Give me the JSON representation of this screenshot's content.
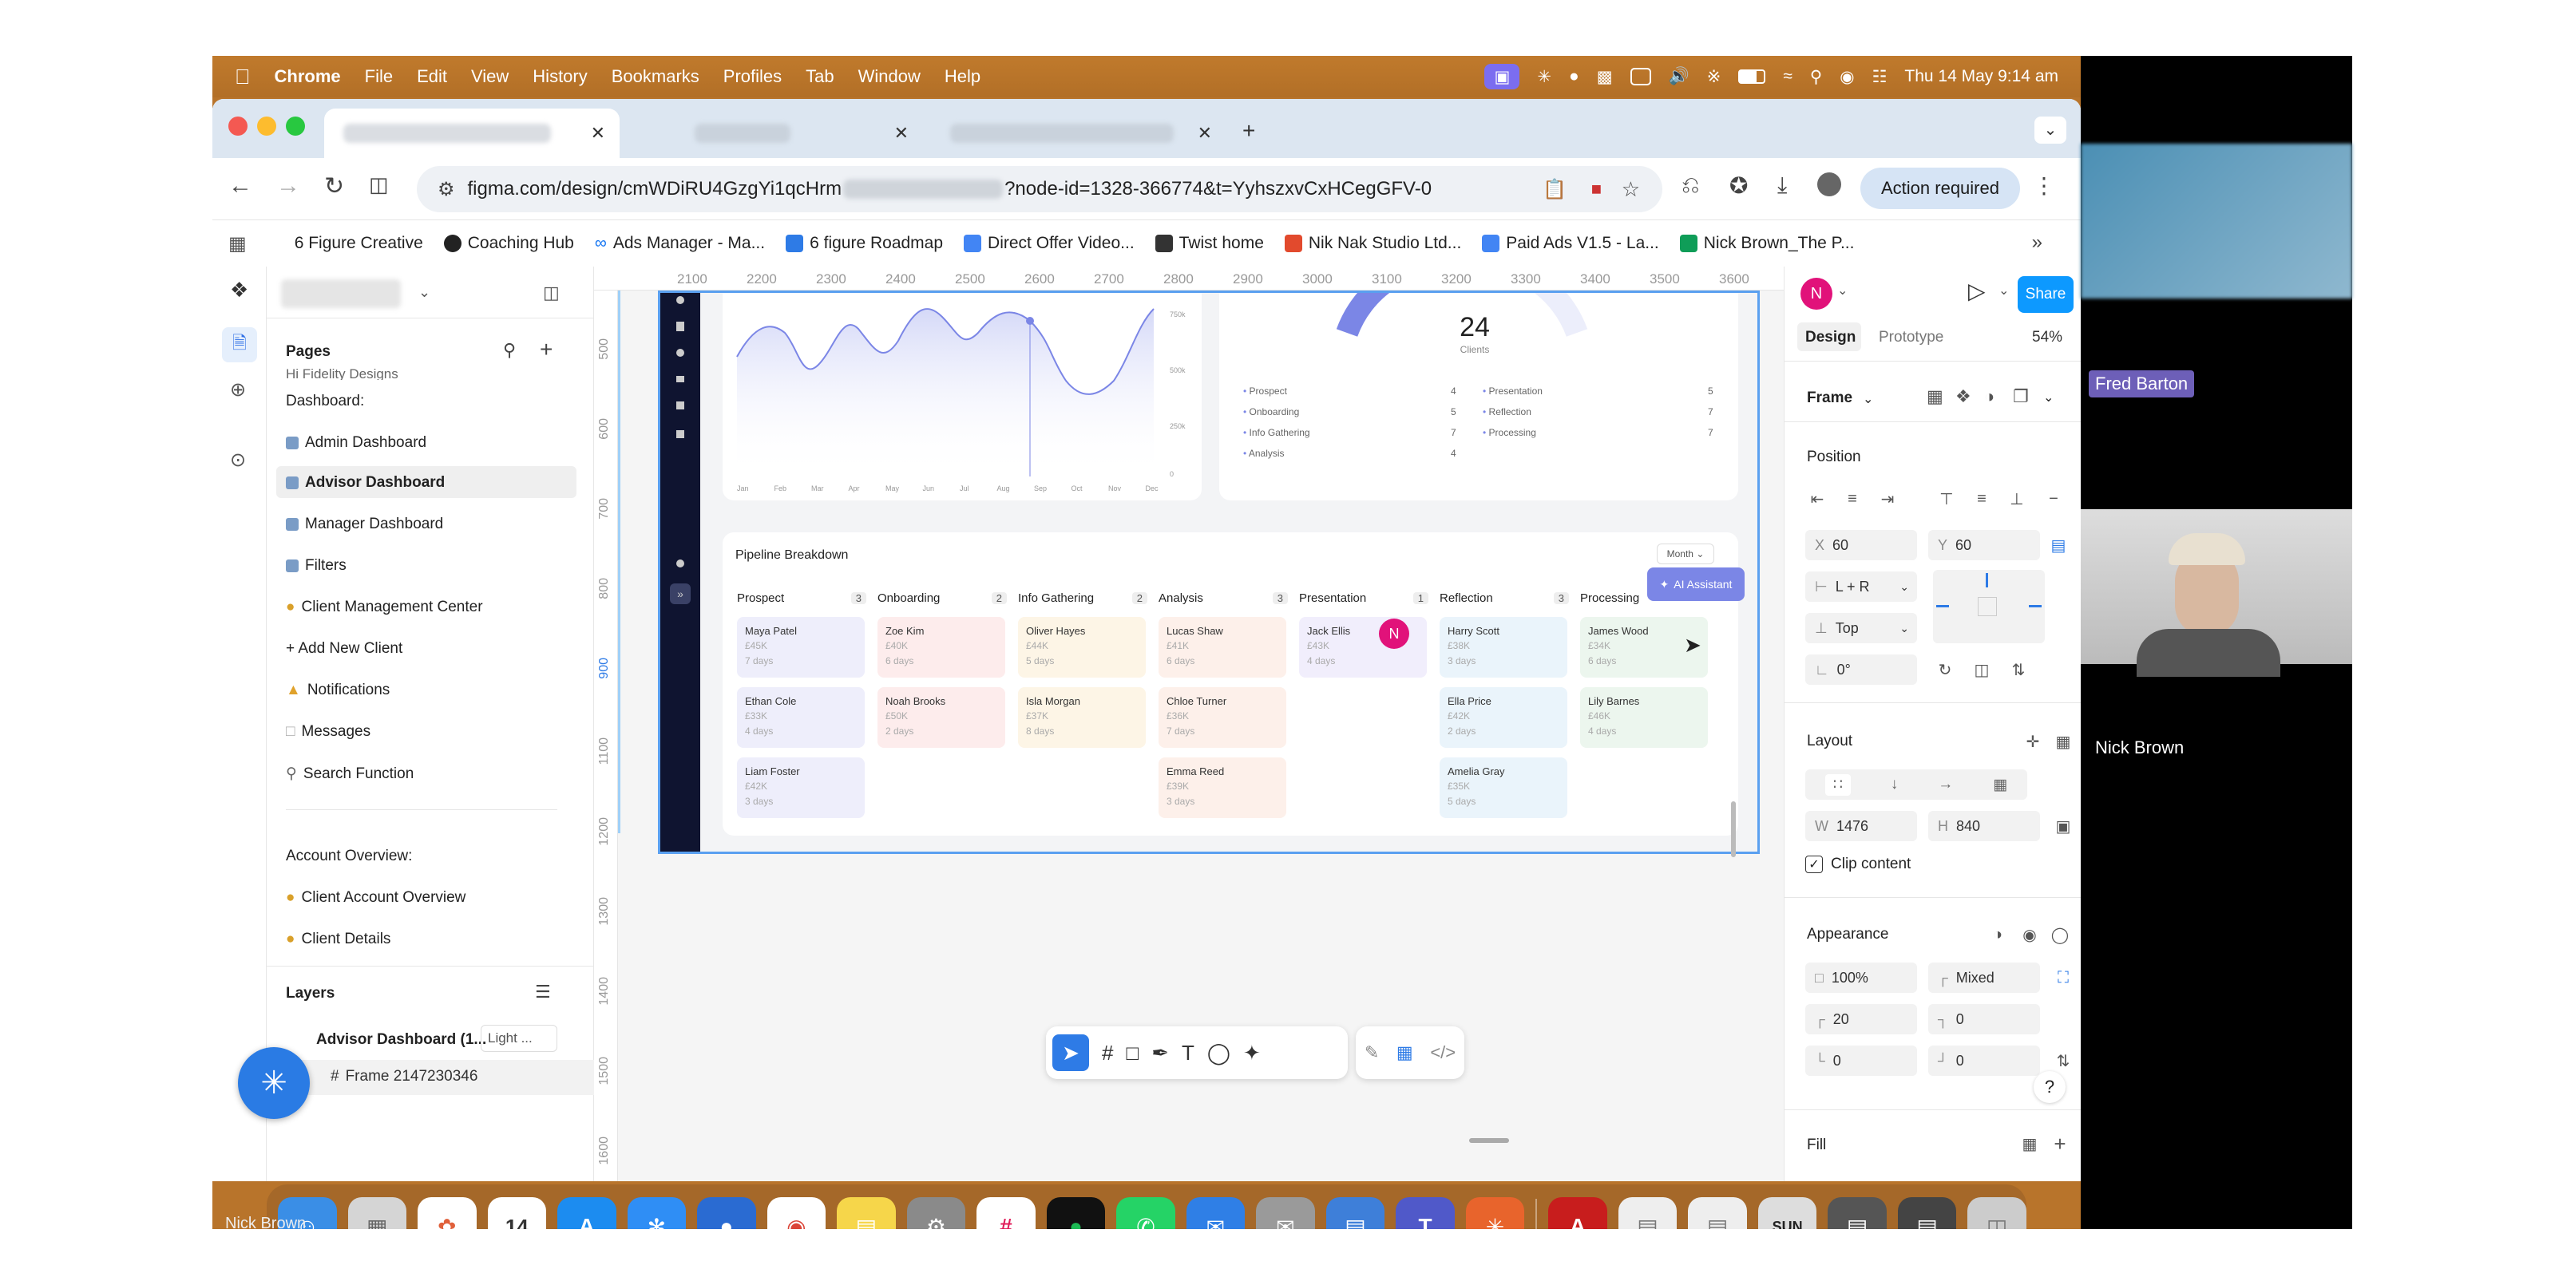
{
  "menubar": {
    "app": "Chrome",
    "items": [
      "File",
      "Edit",
      "View",
      "History",
      "Bookmarks",
      "Profiles",
      "Tab",
      "Window",
      "Help"
    ],
    "datetime": "Thu 14 May  9:14 am"
  },
  "browser": {
    "url_prefix": "figma.com/design/cmWDiRU4GzgYi1qcHrm",
    "url_suffix": "?node-id=1328-366774&t=YyhszxvCxHCegGFV-0",
    "action": "Action required"
  },
  "bookmarks": [
    "6 Figure Creative",
    "Coaching Hub",
    "Ads Manager - Ma...",
    "6 figure Roadmap",
    "Direct Offer Video...",
    "Twist home",
    "Nik Nak Studio Ltd...",
    "Paid Ads V1.5 - La...",
    "Nick Brown_The P..."
  ],
  "pages": {
    "title": "Pages",
    "partial": "Hi Fidelity Designs",
    "dashboard_label": "Dashboard:",
    "items": [
      "Admin Dashboard",
      "Advisor Dashboard",
      "Manager Dashboard",
      "Filters",
      "Client Management Center",
      "+ Add New Client",
      "Notifications",
      "Messages",
      "Search Function"
    ],
    "account_label": "Account Overview:",
    "account_items": [
      "Client Account Overview",
      "Client Details"
    ]
  },
  "layers": {
    "title": "Layers",
    "item1": "Advisor Dashboard (1...",
    "item1_mode": "Light ...",
    "item2": "Frame 2147230346"
  },
  "ruler": {
    "top": [
      "2100",
      "2200",
      "2300",
      "2400",
      "2500",
      "2600",
      "2700",
      "2800",
      "2900",
      "3000",
      "3100",
      "3200",
      "3300",
      "3400",
      "3500",
      "3600"
    ],
    "left": [
      "500",
      "600",
      "700",
      "800",
      "900",
      "1100",
      "1200",
      "1300",
      "1400",
      "1500",
      "1600"
    ]
  },
  "design": {
    "tab_design": "Design",
    "tab_prototype": "Prototype",
    "zoom": "54%",
    "frame": "Frame",
    "share": "Share",
    "avatar": "N",
    "position": "Position",
    "x": "60",
    "y": "60",
    "x_label": "X",
    "y_label": "Y",
    "constraint_h": "L + R",
    "constraint_v": "Top",
    "rotation": "0°",
    "layout": "Layout",
    "w": "1476",
    "h": "840",
    "w_label": "W",
    "h_label": "H",
    "clip": "Clip content",
    "appearance": "Appearance",
    "opacity": "100%",
    "radius_mode": "Mixed",
    "r1": "20",
    "r2": "0",
    "r3": "0",
    "r4": "0",
    "fill": "Fill"
  },
  "dashboard": {
    "months": [
      "Jan",
      "Feb",
      "Mar",
      "Apr",
      "May",
      "Jun",
      "Jul",
      "Aug",
      "Sep",
      "Oct",
      "Nov",
      "Dec"
    ],
    "yticks": [
      "750k",
      "500k",
      "250k",
      "0"
    ],
    "gauge_value": "24",
    "gauge_label": "Clients",
    "legend": [
      [
        "Prospect",
        "4"
      ],
      [
        "Onboarding",
        "5"
      ],
      [
        "Info Gathering",
        "7"
      ],
      [
        "Analysis",
        "4"
      ]
    ],
    "legend2": [
      [
        "Presentation",
        "5"
      ],
      [
        "Reflection",
        "7"
      ],
      [
        "Processing",
        "7"
      ]
    ],
    "pipeline_title": "Pipeline Breakdown",
    "month": "Month",
    "ai": "AI Assistant",
    "columns": [
      {
        "name": "Prospect",
        "count": "3",
        "color": "#eeeefb",
        "cards": [
          [
            "Maya Patel",
            "£45K",
            "7 days"
          ],
          [
            "Ethan Cole",
            "£33K",
            "4 days"
          ],
          [
            "Liam Foster",
            "£42K",
            "3 days"
          ]
        ]
      },
      {
        "name": "Onboarding",
        "count": "2",
        "color": "#fdecec",
        "cards": [
          [
            "Zoe Kim",
            "£40K",
            "6 days"
          ],
          [
            "Noah Brooks",
            "£50K",
            "2 days"
          ]
        ]
      },
      {
        "name": "Info Gathering",
        "count": "2",
        "color": "#fdf5e6",
        "cards": [
          [
            "Oliver Hayes",
            "£44K",
            "5 days"
          ],
          [
            "Isla Morgan",
            "£37K",
            "8 days"
          ]
        ]
      },
      {
        "name": "Analysis",
        "count": "3",
        "color": "#fdf0ea",
        "cards": [
          [
            "Lucas Shaw",
            "£41K",
            "6 days"
          ],
          [
            "Chloe Turner",
            "£36K",
            "7 days"
          ],
          [
            "Emma Reed",
            "£39K",
            "3 days"
          ]
        ]
      },
      {
        "name": "Presentation",
        "count": "1",
        "color": "#f1eefc",
        "cards": [
          [
            "Jack Ellis",
            "£43K",
            "4 days"
          ]
        ]
      },
      {
        "name": "Reflection",
        "count": "3",
        "color": "#eaf4fb",
        "cards": [
          [
            "Harry Scott",
            "£38K",
            "3 days"
          ],
          [
            "Ella Price",
            "£42K",
            "2 days"
          ],
          [
            "Amelia Gray",
            "£35K",
            "5 days"
          ]
        ]
      },
      {
        "name": "Processing",
        "count": "",
        "color": "#ecf6ee",
        "cards": [
          [
            "James Wood",
            "£34K",
            "6 days"
          ],
          [
            "Lily Barnes",
            "£46K",
            "4 days"
          ]
        ]
      }
    ],
    "cursor_avatar": "N"
  },
  "video": {
    "p1": "Fred Barton",
    "p2": "Nick Brown",
    "footer": "Nick Brown"
  },
  "dock": {
    "cal": "14"
  }
}
